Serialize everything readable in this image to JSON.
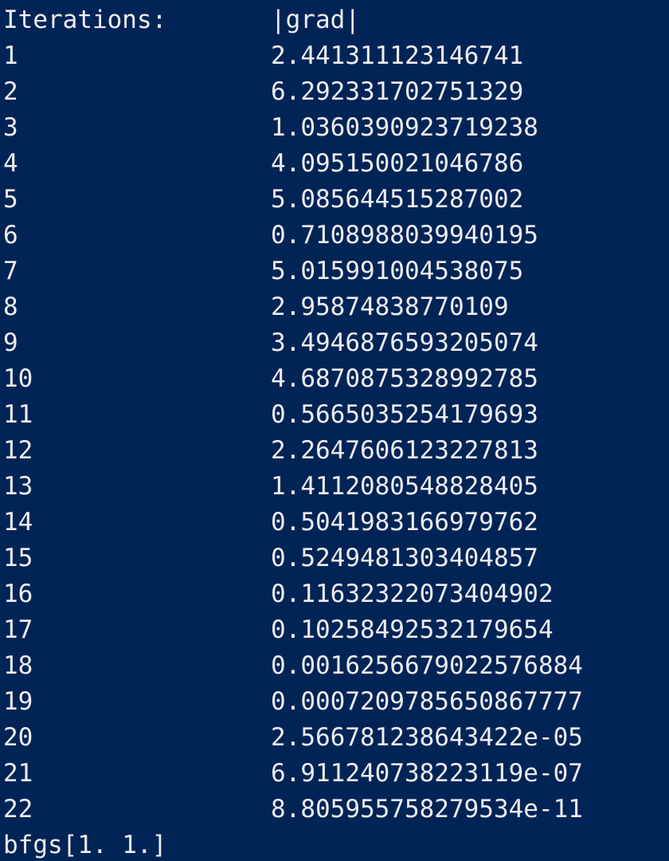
{
  "console": {
    "header": {
      "iterations_label": "Iterations:",
      "grad_label": "|grad|"
    },
    "rows": [
      {
        "iter": "1",
        "grad": "2.441311123146741"
      },
      {
        "iter": "2",
        "grad": "6.292331702751329"
      },
      {
        "iter": "3",
        "grad": "1.0360390923719238"
      },
      {
        "iter": "4",
        "grad": "4.095150021046786"
      },
      {
        "iter": "5",
        "grad": "5.085644515287002"
      },
      {
        "iter": "6",
        "grad": "0.7108988039940195"
      },
      {
        "iter": "7",
        "grad": "5.015991004538075"
      },
      {
        "iter": "8",
        "grad": "2.95874838770109"
      },
      {
        "iter": "9",
        "grad": "3.4946876593205074"
      },
      {
        "iter": "10",
        "grad": "4.6870875328992785"
      },
      {
        "iter": "11",
        "grad": "0.5665035254179693"
      },
      {
        "iter": "12",
        "grad": "2.2647606123227813"
      },
      {
        "iter": "13",
        "grad": "1.4112080548828405"
      },
      {
        "iter": "14",
        "grad": "0.5041983166979762"
      },
      {
        "iter": "15",
        "grad": "0.5249481303404857"
      },
      {
        "iter": "16",
        "grad": "0.11632322073404902"
      },
      {
        "iter": "17",
        "grad": "0.10258492532179654"
      },
      {
        "iter": "18",
        "grad": "0.0016256679022576884"
      },
      {
        "iter": "19",
        "grad": "0.0007209785650867777"
      },
      {
        "iter": "20",
        "grad": "2.566781238643422e-05"
      },
      {
        "iter": "21",
        "grad": "6.911240738223119e-07"
      },
      {
        "iter": "22",
        "grad": "8.805955758279534e-11"
      }
    ],
    "result_line": "bfgs[1. 1.]"
  },
  "colors": {
    "background": "#012456",
    "text": "#eeedf0"
  }
}
